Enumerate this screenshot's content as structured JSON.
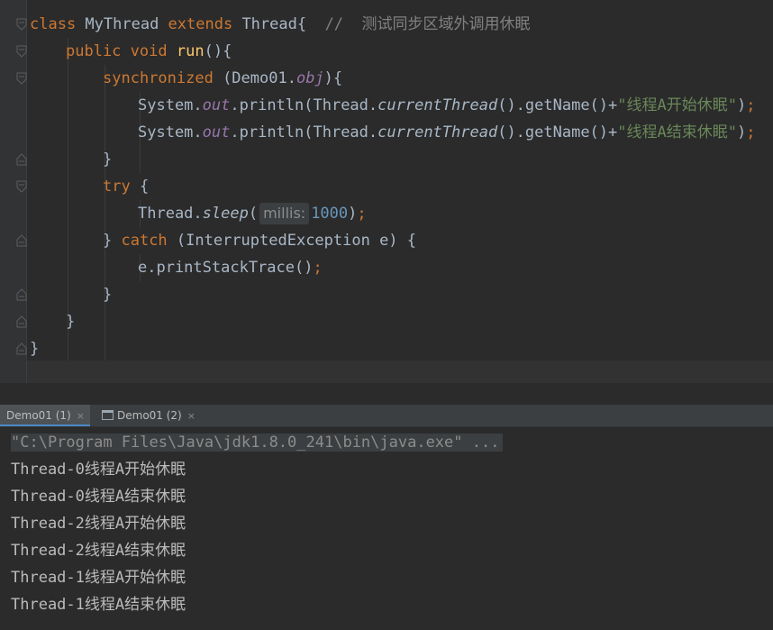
{
  "editor": {
    "lines": [
      {
        "parts": [
          [
            "kw",
            "class"
          ],
          [
            "plain",
            " MyThread "
          ],
          [
            "kw",
            "extends"
          ],
          [
            "plain",
            " Thread{  "
          ],
          [
            "cmt",
            "//  测试同步区域外调用休眠"
          ]
        ]
      },
      {
        "parts": [
          [
            "kw",
            "public"
          ],
          [
            "plain",
            " "
          ],
          [
            "kw",
            "void"
          ],
          [
            "plain",
            " "
          ],
          [
            "fn",
            "run"
          ],
          [
            "plain",
            "(){"
          ]
        ]
      },
      {
        "parts": [
          [
            "kw",
            "synchronized"
          ],
          [
            "plain",
            " (Demo01."
          ],
          [
            "stat",
            "obj"
          ],
          [
            "plain",
            "){"
          ]
        ]
      },
      {
        "parts": [
          [
            "plain",
            "System."
          ],
          [
            "stat",
            "out"
          ],
          [
            "plain",
            ".println(Thread."
          ],
          [
            "ital",
            "currentThread"
          ],
          [
            "plain",
            "().getName()+"
          ],
          [
            "str",
            "\"线程A开始休眠\""
          ],
          [
            "plain",
            ")"
          ],
          [
            "kw",
            ";"
          ]
        ]
      },
      {
        "parts": [
          [
            "plain",
            "System."
          ],
          [
            "stat",
            "out"
          ],
          [
            "plain",
            ".println(Thread."
          ],
          [
            "ital",
            "currentThread"
          ],
          [
            "plain",
            "().getName()+"
          ],
          [
            "str",
            "\"线程A结束休眠\""
          ],
          [
            "plain",
            ")"
          ],
          [
            "kw",
            ";"
          ]
        ]
      },
      {
        "parts": [
          [
            "plain",
            "}"
          ]
        ]
      },
      {
        "parts": [
          [
            "kw",
            "try"
          ],
          [
            "plain",
            " {"
          ]
        ]
      },
      {
        "parts": [
          [
            "plain",
            "Thread."
          ],
          [
            "ital",
            "sleep"
          ],
          [
            "plain",
            "("
          ],
          [
            "hint",
            "millis:"
          ],
          [
            "num",
            "1000"
          ],
          [
            "plain",
            ")"
          ],
          [
            "kw",
            ";"
          ]
        ]
      },
      {
        "parts": [
          [
            "plain",
            "} "
          ],
          [
            "kw",
            "catch"
          ],
          [
            "plain",
            " (InterruptedException e) {"
          ]
        ]
      },
      {
        "parts": [
          [
            "plain",
            "e.printStackTrace()"
          ],
          [
            "kw",
            ";"
          ]
        ]
      },
      {
        "parts": [
          [
            "plain",
            "}"
          ]
        ]
      },
      {
        "parts": [
          [
            "plain",
            "}"
          ]
        ]
      },
      {
        "parts": [
          [
            "plain",
            "}"
          ]
        ]
      }
    ]
  },
  "run_tabs": [
    {
      "label": "Demo01 (1)",
      "close": "×"
    },
    {
      "label": "Demo01 (2)",
      "close": "×"
    }
  ],
  "console": {
    "command": "\"C:\\Program Files\\Java\\jdk1.8.0_241\\bin\\java.exe\" ...",
    "output": [
      "Thread-0线程A开始休眠",
      "Thread-0线程A结束休眠",
      "Thread-2线程A开始休眠",
      "Thread-2线程A结束休眠",
      "Thread-1线程A开始休眠",
      "Thread-1线程A结束休眠"
    ]
  }
}
